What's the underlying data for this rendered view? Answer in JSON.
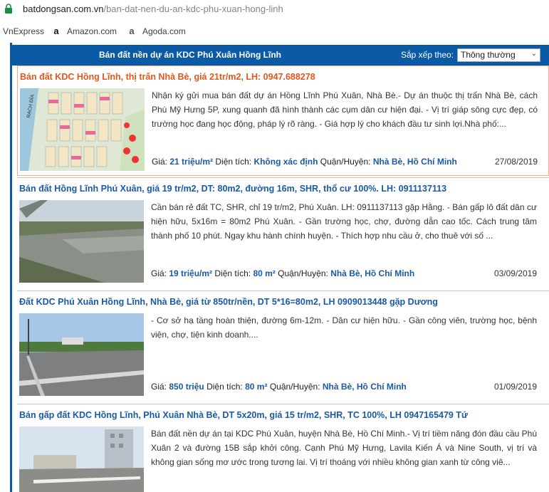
{
  "browser": {
    "url_host": "batdongsan.com.vn",
    "url_path": "/ban-dat-nen-du-an-kdc-phu-xuan-hong-linh",
    "bookmarks": [
      {
        "label": "VnExpress",
        "icon": "vnexpress-icon"
      },
      {
        "label": "Amazon.com",
        "icon": "amazon-icon"
      },
      {
        "label": "Agoda.com",
        "icon": "agoda-icon"
      }
    ]
  },
  "header": {
    "title": "Bán đất nền dự án KDC Phú Xuân Hồng Lĩnh",
    "sort_label": "Sắp xếp theo:",
    "sort_value": "Thông thường"
  },
  "labels": {
    "price": "Giá:",
    "area": "Diện tích:",
    "district": "Quận/Huyện:"
  },
  "listings": [
    {
      "title": "Bán đất KDC Hồng Lĩnh, thị trấn Nhà Bè, giá 21tr/m2, LH: 0947.688278",
      "description": "Nhận ký gửi mua bán đất dự án Hồng Lĩnh Phú Xuân, Nhà Bè.- Dự án thuộc thị trấn Nhà Bè, cách Phú Mỹ Hưng 5P, xung quanh đã hình thành các cụm dân cư hiện đại. - Vị trí giáp sông cực đẹp, có trường học đang học động, pháp lý rõ ràng. - Giá hợp lý cho khách đầu tư sinh lợi.Nhà phố:...",
      "price": "21 triệu/m²",
      "area": "Không xác định",
      "district": "Nhà Bè, Hồ Chí Minh",
      "date": "27/08/2019"
    },
    {
      "title": "Bán đất Hồng Lĩnh Phú Xuân, giá 19 tr/m2, DT: 80m2, đường 16m, SHR, thổ cư 100%. LH: 0911137113",
      "description": "Cần bán rẻ đất TC, SHR, chỉ 19 tr/m2, Phú Xuân. LH: 0911137113 gặp Hằng. - Bán gấp lô đất dân cư hiện hữu, 5x16m = 80m2 Phú Xuân. - Gần trường học, chợ, đường dẫn cao tốc. Cách trung tâm thành phố 10 phút. Ngay khu hành chính huyện. - Thích hợp nhu cầu ở, cho thuê với số ...",
      "price": "19 triệu/m²",
      "area": "80 m²",
      "district": "Nhà Bè, Hồ Chí Minh",
      "date": "03/09/2019"
    },
    {
      "title": "Đất KDC Phú Xuân Hồng Lĩnh, Nhà Bè, giá từ 850tr/nền, DT 5*16=80m2, LH 0909013448 gặp Dương",
      "description": "- Cơ sở hạ tầng hoàn thiện, đường 6m-12m. - Dân cư hiện hữu. - Gần công viên, trường học, bệnh viện, chợ, tiện kinh doanh....",
      "price": "850 triệu",
      "area": "80 m²",
      "district": "Nhà Bè, Hồ Chí Minh",
      "date": "01/09/2019"
    },
    {
      "title": "Bán gấp đất KDC Hồng Lĩnh, Phú Xuân Nhà Bè, DT 5x20m, giá 15 tr/m2, SHR, TC 100%, LH 0947165479 Tứ",
      "description": "Bán đất nền dự án tại KDC Phú Xuân, huyện Nhà Bè, Hồ Chí Minh.- Vị trí tiềm năng đón đầu cầu Phú Xuân 2 và đường 15B sắp khởi công. Cạnh Phú Mỹ Hưng, Lavila Kiến Á và Nine South, vị trí và không gian sống mơ ước trong tương lai. Vị trí thoáng với nhiều không gian xanh từ công viê...",
      "price": "",
      "area": "",
      "district": "",
      "date": ""
    }
  ],
  "thumb_text": {
    "map_label": "RẠCH ĐỈA"
  }
}
